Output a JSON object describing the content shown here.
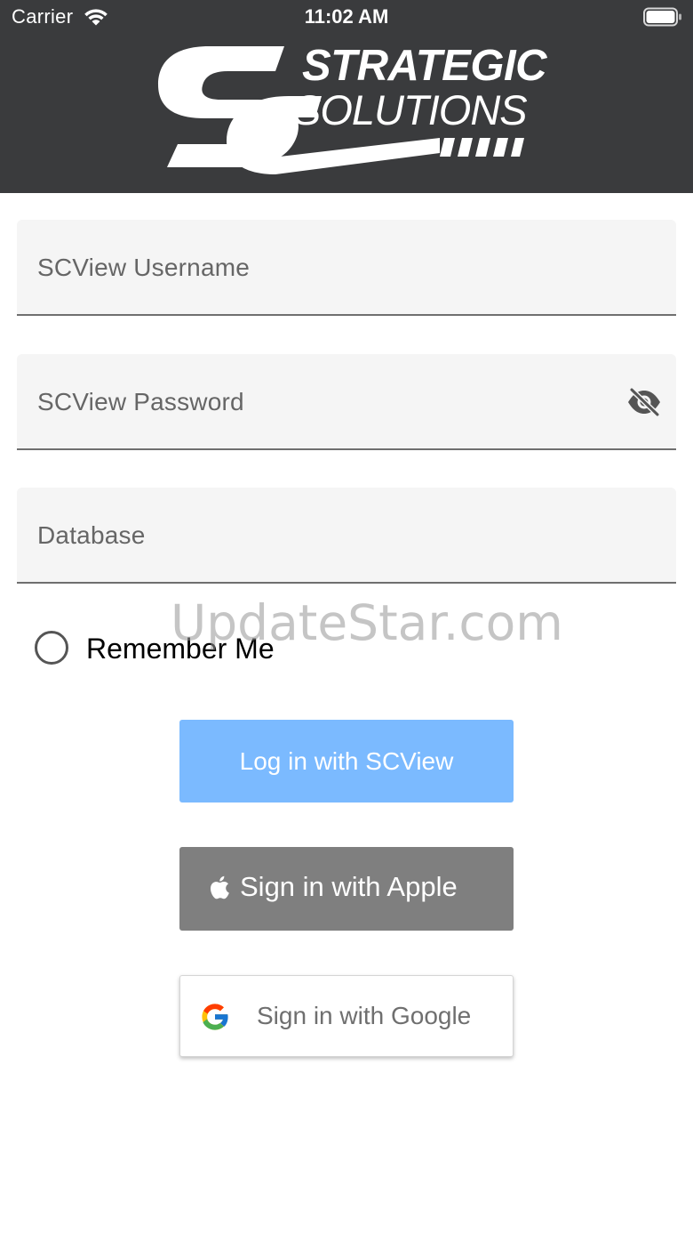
{
  "status_bar": {
    "carrier": "Carrier",
    "time": "11:02 AM",
    "wifi_icon": "wifi-icon",
    "battery_icon": "battery-icon"
  },
  "logo": {
    "line1": "STRATEGIC",
    "line2": "SOLUTIONS",
    "mark": "sc-monogram"
  },
  "form": {
    "username_placeholder": "SCView Username",
    "password_placeholder": "SCView Password",
    "password_toggle_icon": "eye-off-icon",
    "database_placeholder": "Database",
    "remember_label": "Remember Me",
    "remember_checked": false
  },
  "buttons": {
    "scview": "Log in with SCView",
    "apple": "Sign in with Apple",
    "google": "Sign in with Google"
  },
  "watermark": "UpdateStar.com",
  "colors": {
    "header_bg": "#3a3b3d",
    "scview_button": "#7bbaff",
    "apple_button": "#7f7f7f",
    "field_bg": "#f5f5f5"
  }
}
